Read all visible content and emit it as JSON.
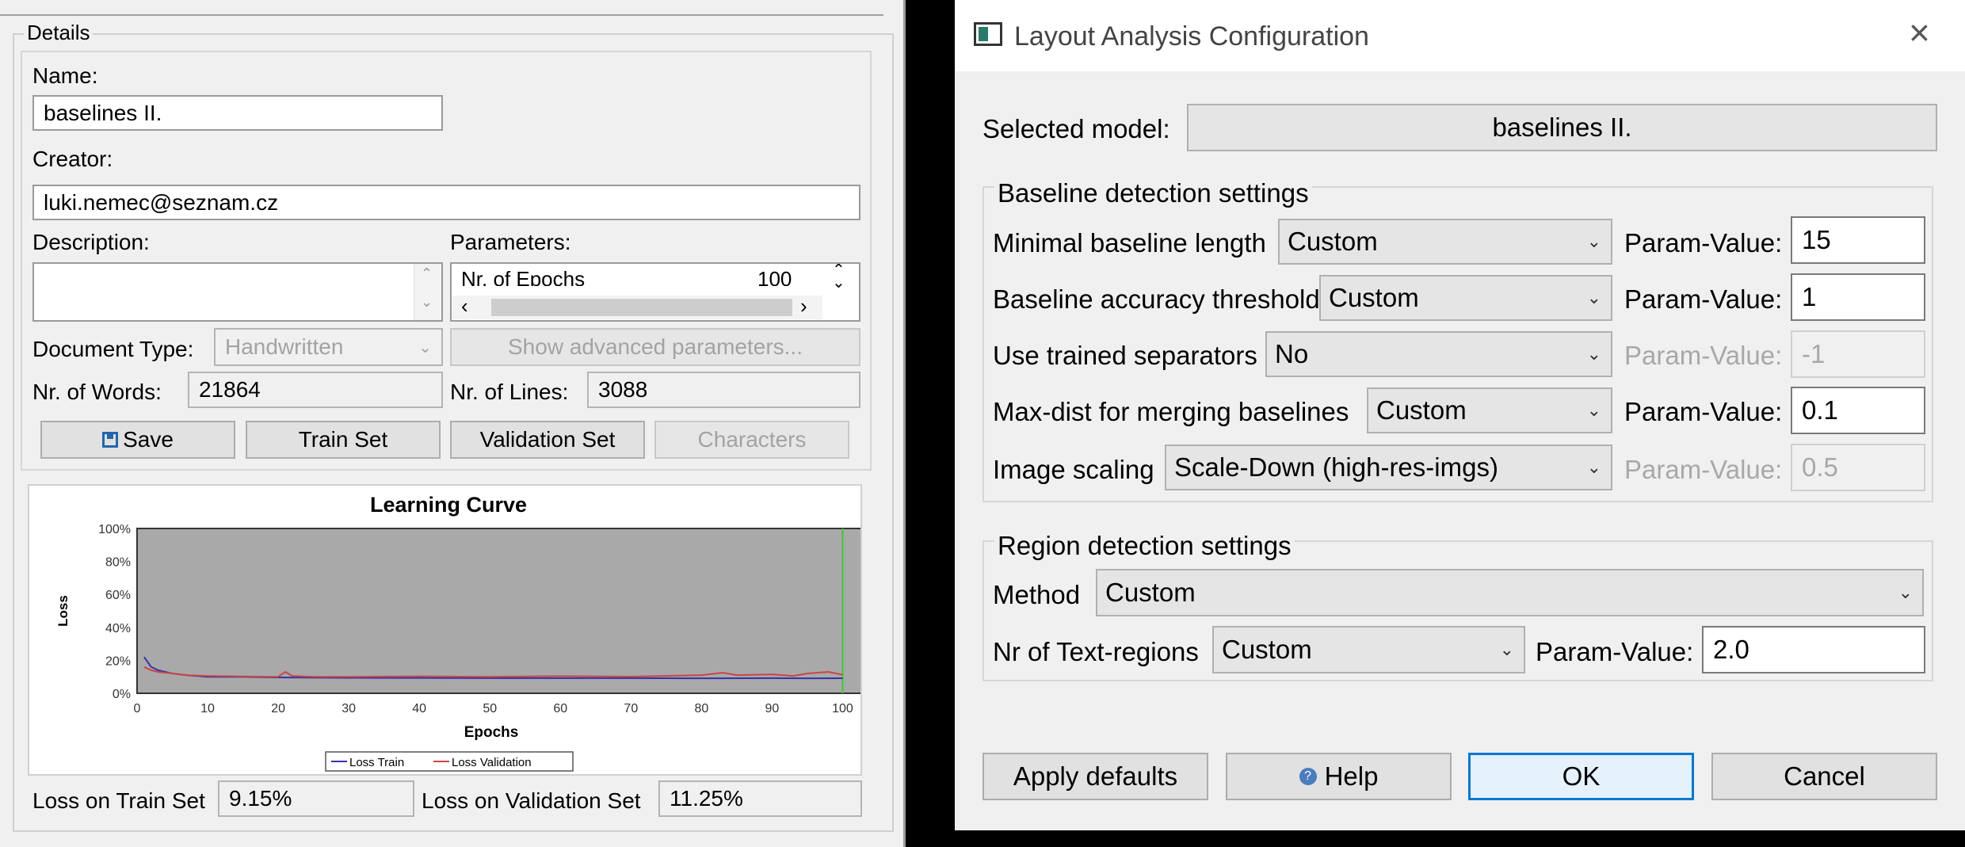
{
  "details": {
    "title": "Details",
    "name_label": "Name:",
    "name_value": "baselines II.",
    "creator_label": "Creator:",
    "creator_value": "luki.nemec@seznam.cz",
    "description_label": "Description:",
    "description_value": "",
    "parameters_label": "Parameters:",
    "parameters_row_name": "Nr. of Epochs",
    "parameters_row_value": "100",
    "document_type_label": "Document Type:",
    "document_type_value": "Handwritten",
    "advanced_button": "Show advanced parameters...",
    "words_label": "Nr. of Words:",
    "words_value": "21864",
    "lines_label": "Nr. of Lines:",
    "lines_value": "3088",
    "save_button": "Save",
    "train_set_button": "Train Set",
    "validation_set_button": "Validation Set",
    "characters_button": "Characters",
    "loss_train_label": "Loss on Train Set",
    "loss_train_value": "9.15%",
    "loss_validation_label": "Loss on Validation Set",
    "loss_validation_value": "11.25%"
  },
  "chart_data": {
    "type": "line",
    "title": "Learning Curve",
    "xlabel": "Epochs",
    "ylabel": "Loss",
    "xlim": [
      0,
      105
    ],
    "ylim": [
      0,
      100
    ],
    "x_ticks": [
      0,
      10,
      20,
      30,
      40,
      50,
      60,
      70,
      80,
      90,
      100
    ],
    "y_ticks": [
      "0%",
      "20%",
      "40%",
      "60%",
      "80%",
      "100%"
    ],
    "grid": false,
    "background": "#a9a9a9",
    "marker_line_x": 100,
    "marker_line_color": "#33cc33",
    "legend_position": "bottom",
    "series": [
      {
        "name": "Loss Train",
        "color": "#3333aa",
        "x": [
          1,
          2,
          3,
          5,
          7,
          10,
          15,
          20,
          25,
          30,
          40,
          50,
          60,
          70,
          80,
          90,
          95,
          100
        ],
        "y": [
          22,
          16,
          14,
          12,
          11,
          10,
          10,
          9.6,
          9.5,
          9.4,
          9.3,
          9.2,
          9.2,
          9.2,
          9.1,
          9.2,
          9.1,
          9.15
        ]
      },
      {
        "name": "Loss Validation",
        "color": "#cc4444",
        "x": [
          1,
          2,
          3,
          5,
          7,
          10,
          15,
          20,
          21,
          22,
          25,
          30,
          40,
          50,
          60,
          70,
          80,
          83,
          85,
          90,
          93,
          95,
          98,
          100
        ],
        "y": [
          16,
          14,
          13,
          12,
          11,
          10.5,
          10.2,
          10,
          13,
          10.5,
          10,
          10,
          10.3,
          10,
          10.4,
          10.1,
          11,
          12.5,
          11,
          11.5,
          10.5,
          12,
          13,
          11.25
        ]
      }
    ]
  },
  "dialog": {
    "title": "Layout Analysis Configuration",
    "selected_model_label": "Selected model:",
    "selected_model_value": "baselines II.",
    "baseline_group_title": "Baseline detection settings",
    "param_value_label": "Param-Value:",
    "baseline_rows": [
      {
        "label": "Minimal baseline length",
        "option": "Custom",
        "value": "15",
        "enabled": true
      },
      {
        "label": "Baseline accuracy threshold",
        "option": "Custom",
        "value": "1",
        "enabled": true
      },
      {
        "label": "Use trained separators",
        "option": "No",
        "value": "-1",
        "enabled": false
      },
      {
        "label": "Max-dist for merging baselines",
        "option": "Custom",
        "value": "0.1",
        "enabled": true
      },
      {
        "label": "Image scaling",
        "option": "Scale-Down (high-res-imgs)",
        "value": "0.5",
        "enabled": false
      }
    ],
    "region_group_title": "Region detection settings",
    "method_label": "Method",
    "method_value": "Custom",
    "text_regions_label": "Nr of Text-regions",
    "text_regions_option": "Custom",
    "text_regions_value": "2.0",
    "apply_defaults_button": "Apply defaults",
    "help_button": "Help",
    "ok_button": "OK",
    "cancel_button": "Cancel"
  }
}
